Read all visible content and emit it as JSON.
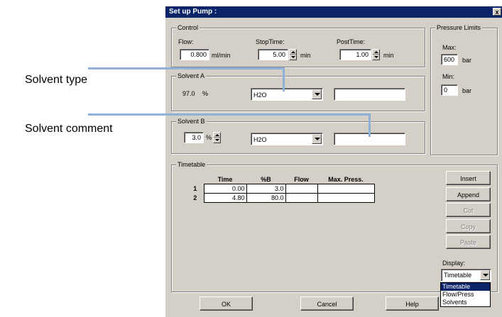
{
  "callouts": {
    "solvent_type": "Solvent type",
    "solvent_comment": "Solvent comment"
  },
  "dialog": {
    "title": "Set up Pump :",
    "close_glyph": "x"
  },
  "control": {
    "group_label": "Control",
    "flow_label": "Flow:",
    "flow_value": "0.800",
    "flow_unit": "ml/min",
    "stoptime_label": "StopTime:",
    "stoptime_value": "5.00",
    "stoptime_unit": "min",
    "posttime_label": "PostTime:",
    "posttime_value": "1.00",
    "posttime_unit": "min"
  },
  "pressure": {
    "group_label": "Pressure Limits",
    "max_label": "Max:",
    "max_value": "600",
    "max_unit": "bar",
    "min_label": "Min:",
    "min_value": "0",
    "min_unit": "bar"
  },
  "solvent_a": {
    "group_label": "Solvent A",
    "percent": "97.0",
    "percent_unit": "%",
    "type": "H2O",
    "comment": ""
  },
  "solvent_b": {
    "group_label": "Solvent B",
    "percent": "3.0",
    "percent_unit": "%",
    "type": "H2O",
    "comment": ""
  },
  "timetable": {
    "group_label": "Timetable",
    "columns": [
      "Time",
      "%B",
      "Flow",
      "Max. Press."
    ],
    "rows": [
      {
        "n": "1",
        "time": "0.00",
        "b": "3.0",
        "flow": "",
        "maxp": ""
      },
      {
        "n": "2",
        "time": "4.80",
        "b": "80.0",
        "flow": "",
        "maxp": ""
      }
    ],
    "buttons": {
      "insert": "Insert",
      "append": "Append",
      "cut": "Cut",
      "copy": "Copy",
      "paste": "Paste"
    },
    "display_label": "Display:",
    "display_value": "Timetable",
    "display_options": [
      "Timetable",
      "Flow/Press",
      "Solvents"
    ]
  },
  "footer": {
    "ok": "OK",
    "cancel": "Cancel",
    "help": "Help"
  },
  "colors": {
    "titlebar": "#0a246a",
    "dialog_face": "#d4d0c8",
    "leader_line": "#8fb0d8"
  }
}
